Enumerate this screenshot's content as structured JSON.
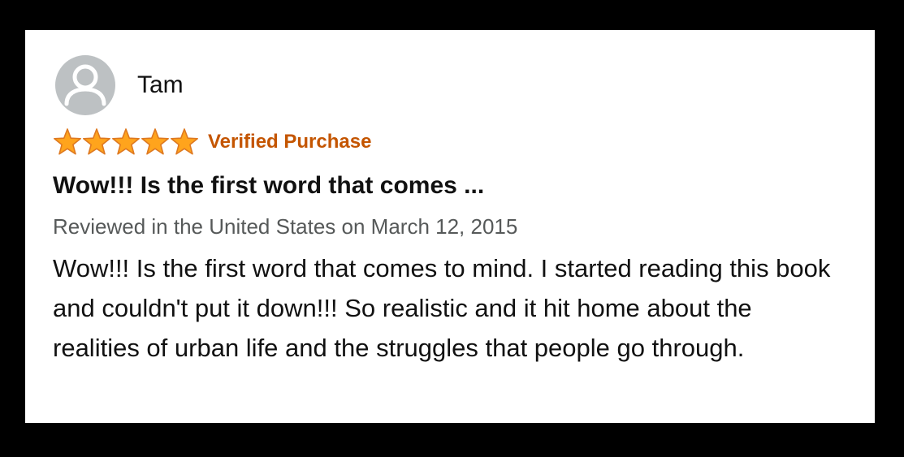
{
  "review": {
    "reviewer_name": "Tam",
    "avatar_icon": "default-user-icon",
    "rating": 5,
    "rating_max": 5,
    "star_icon": "star-icon",
    "verified_label": "Verified Purchase",
    "title": "Wow!!! Is the first word that comes ...",
    "meta": "Reviewed in the United States on March 12, 2015",
    "body": "Wow!!! Is the first word that comes to mind. I started reading this book and couldn't put it down!!! So realistic and it hit home about the realities of urban life and the struggles that people go through."
  },
  "colors": {
    "page_background": "#000000",
    "card_background": "#ffffff",
    "star_fill": "#ffa41c",
    "star_stroke": "#de7921",
    "verified": "#c45500",
    "meta": "#565959",
    "text": "#111111",
    "avatar_background": "#bdc1c3"
  }
}
